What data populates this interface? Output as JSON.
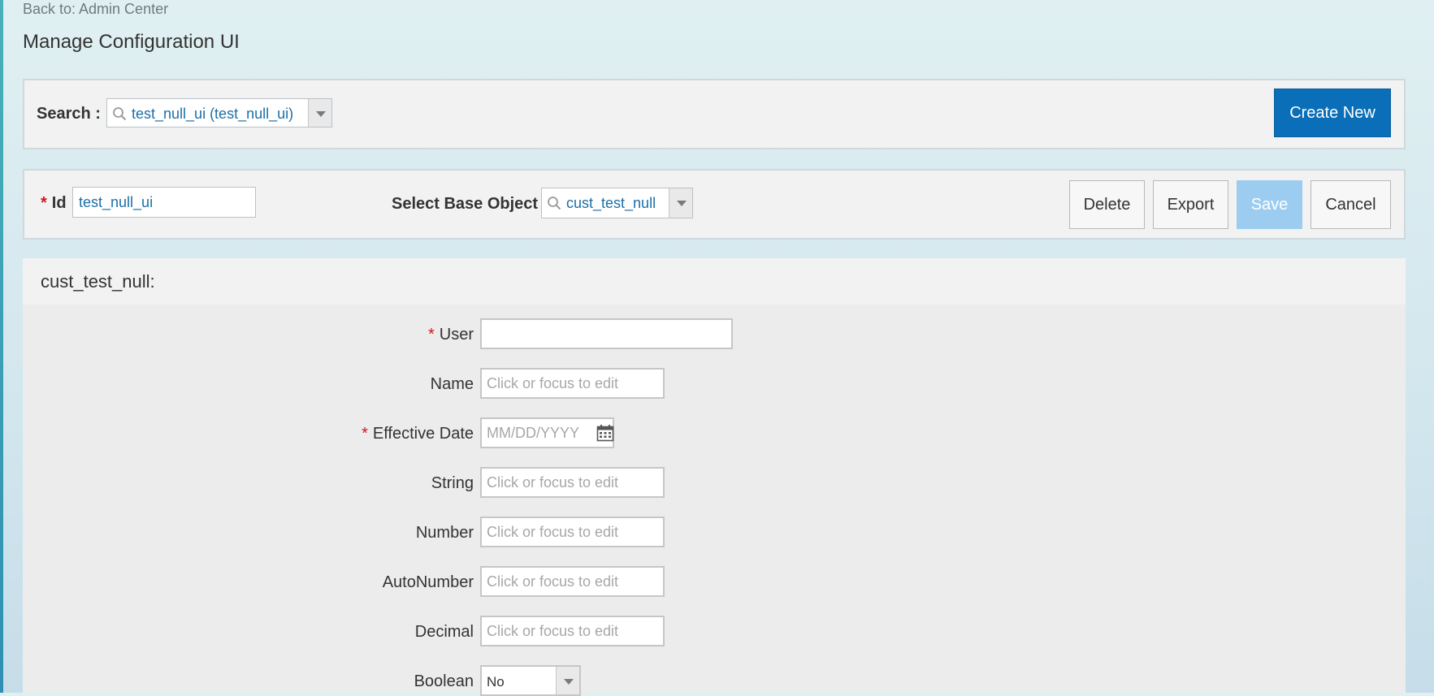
{
  "header": {
    "back_link": "Back to: Admin Center",
    "title": "Manage Configuration UI"
  },
  "search": {
    "label": "Search :",
    "value": "test_null_ui (test_null_ui)",
    "create_new_label": "Create New"
  },
  "config_form": {
    "id_required_mark": "*",
    "id_label": "Id",
    "id_value": "test_null_ui",
    "base_object_label": "Select Base Object",
    "base_object_value": "cust_test_null",
    "buttons": {
      "delete": "Delete",
      "export": "Export",
      "save": "Save",
      "cancel": "Cancel"
    }
  },
  "section": {
    "title": "cust_test_null:",
    "fields": {
      "user": {
        "label": "User",
        "required": "*",
        "value": ""
      },
      "name": {
        "label": "Name",
        "placeholder": "Click or focus to edit"
      },
      "effective_date": {
        "label": "Effective Date",
        "required": "*",
        "placeholder": "MM/DD/YYYY"
      },
      "string": {
        "label": "String",
        "placeholder": "Click or focus to edit"
      },
      "number": {
        "label": "Number",
        "placeholder": "Click or focus to edit"
      },
      "autonumber": {
        "label": "AutoNumber",
        "placeholder": "Click or focus to edit"
      },
      "decimal": {
        "label": "Decimal",
        "placeholder": "Click or focus to edit"
      },
      "boolean": {
        "label": "Boolean",
        "value": "No"
      }
    }
  },
  "colors": {
    "primary": "#0a6fb8",
    "disabled_primary": "#9ccdf0",
    "required": "#d0161c",
    "link_text": "#1c6fa6"
  },
  "icons": {
    "search": "search-icon",
    "dropdown": "chevron-down-icon",
    "calendar": "calendar-icon"
  }
}
